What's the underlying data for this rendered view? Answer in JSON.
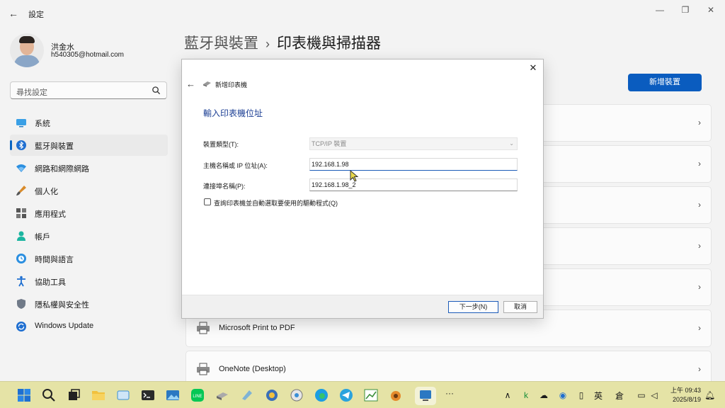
{
  "window": {
    "title": "設定",
    "min": "—",
    "max": "❐",
    "close": "✕"
  },
  "user": {
    "name": "洪金水",
    "email": "h540305@hotmail.com"
  },
  "search": {
    "placeholder": "尋找設定"
  },
  "nav": [
    {
      "label": "系統",
      "icon": "monitor-icon",
      "active": false
    },
    {
      "label": "藍牙與裝置",
      "icon": "bluetooth-icon",
      "active": true
    },
    {
      "label": "網路和網際網路",
      "icon": "wifi-icon",
      "active": false
    },
    {
      "label": "個人化",
      "icon": "brush-icon",
      "active": false
    },
    {
      "label": "應用程式",
      "icon": "apps-icon",
      "active": false
    },
    {
      "label": "帳戶",
      "icon": "person-icon",
      "active": false
    },
    {
      "label": "時間與語言",
      "icon": "globe-clock-icon",
      "active": false
    },
    {
      "label": "協助工具",
      "icon": "accessibility-icon",
      "active": false
    },
    {
      "label": "隱私權與安全性",
      "icon": "shield-icon",
      "active": false
    },
    {
      "label": "Windows Update",
      "icon": "update-icon",
      "active": false
    }
  ],
  "breadcrumb": {
    "parent": "藍牙與裝置",
    "separator": "›",
    "current": "印表機與掃描器"
  },
  "add_device_label": "新增裝置",
  "devices": [
    {
      "label": "Microsoft Print to PDF"
    },
    {
      "label": "OneNote (Desktop)"
    }
  ],
  "dialog": {
    "title": "新增印表機",
    "heading": "輸入印表機位址",
    "device_type_label": "裝置類型(T):",
    "device_type_value": "TCP/IP 裝置",
    "host_label": "主機名稱或 IP 位址(A):",
    "host_value": "192.168.1.98",
    "port_label": "連接埠名稱(P):",
    "port_value": "192.168.1.98_2",
    "checkbox_label": "查詢印表機並自動選取要使用的驅動程式(Q)",
    "checkbox_checked": false,
    "next_label": "下一步(N)",
    "cancel_label": "取消",
    "close": "✕",
    "back": "←"
  },
  "taskbar": {
    "tray": {
      "ime_lang": "英",
      "ime_mode": "倉",
      "chevron": "∧",
      "more": "···"
    },
    "clock": {
      "time": "上午 09:43",
      "date": "2025/8/19"
    }
  },
  "colors": {
    "accent": "#0a5cbf",
    "heading": "#1c3f94",
    "taskbar": "#e5e3a6"
  }
}
